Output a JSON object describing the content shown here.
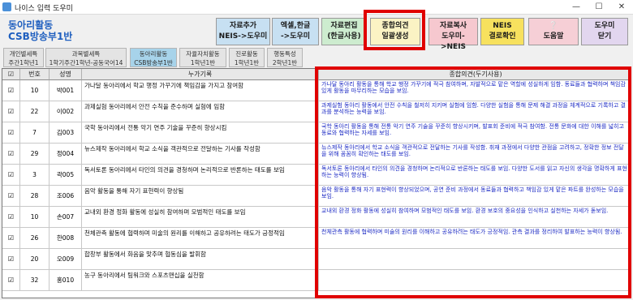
{
  "window": {
    "title": "나이스 입력 도우미",
    "min": "—",
    "max": "☐",
    "close": "✕"
  },
  "dept": {
    "line1": "동아리활동",
    "line2": "CSB방송부1반"
  },
  "toolbar": [
    {
      "id": "add",
      "l1": "자료추가",
      "l2": "NEIS->도우미",
      "bg": "#c7e0f2"
    },
    {
      "id": "excel",
      "l1": "엑셀,한글",
      "l2": "->도우미",
      "bg": "#c7e0f2"
    },
    {
      "id": "edit",
      "l1": "자료편집",
      "l2": "(한글사용)",
      "bg": "#cdeccf"
    },
    {
      "id": "bulk",
      "l1": "종합의견",
      "l2": "일괄생성",
      "bg": "#fbf3c4"
    },
    {
      "id": "copy",
      "l1": "자료복사",
      "l2": "도우미->NEIS",
      "bg": "#f6c8cf"
    },
    {
      "id": "check",
      "l1": "NEIS",
      "l2": "결로확인",
      "bg": "#f7e15e"
    },
    {
      "id": "help",
      "l1": "❔",
      "l2": "도움말",
      "bg": "#f6cfd6"
    },
    {
      "id": "close",
      "l1": "도우미",
      "l2": "닫기",
      "bg": "#e2d6ef"
    }
  ],
  "tabs": [
    {
      "l1": "개인별세특",
      "l2": "주간1학년1",
      "active": false
    },
    {
      "l1": "과목별세특",
      "l2": "1학기주간1학년-공동국어14",
      "active": false
    },
    {
      "l1": "동아리활동",
      "l2": "CSB방송부1반",
      "active": true
    },
    {
      "l1": "자율자치활동",
      "l2": "1학년1반",
      "active": false
    },
    {
      "l1": "진로활동",
      "l2": "1학년1반",
      "active": false
    },
    {
      "l1": "행동특성",
      "l2": "2학년1반",
      "active": false
    }
  ],
  "grid": {
    "headers": {
      "check": "☑",
      "number": "번호",
      "name": "성명",
      "record": "누가기록",
      "opinion": "종합의견(두기사용)"
    },
    "rows": [
      {
        "checked": "☑",
        "number": "10",
        "name": "박001",
        "record": "가나달 동아리에서 학교 행정 가꾸기에 책임감을 가지고 참여함",
        "opinion": "가나달 동아리 활동을 통해 학교 행정 가꾸기에 적극 참여하며, 자발적으로 맡은 역할에 성실하게 임함. 동료들과 협력하며 책임감 있게 활동을 마무리하는 모습을 보임."
      },
      {
        "checked": "☑",
        "number": "22",
        "name": "이002",
        "record": "과제실험 동아리에서 안전 수칙을 준수하며 실험에 임함",
        "opinion": "과제실험 동아리 활동에서 안전 수칙을 철저히 지키며 실험에 임함. 다양한 실험을 통해 문제 해결 과정을 체계적으로 기록하고 결과를 분석하는 능력을 보임."
      },
      {
        "checked": "☑",
        "number": "7",
        "name": "김003",
        "record": "국학 동아리에서 전통 악기 연주 기술을 꾸준히 향상시킴",
        "opinion": "국학 동아리 활동을 통해 전통 악기 연주 기술을 꾸준히 향상시키며, 발표회 준비에 적극 참여함. 전통 문화에 대한 이해를 넓히고 동료와 협력하는 자세를 보임."
      },
      {
        "checked": "☑",
        "number": "29",
        "name": "정004",
        "record": "뉴스제작 동아리에서 학교 소식을 객관적으로 전달하는 기사를 작성함",
        "opinion": "뉴스제작 동아리에서 학교 소식을 객관적으로 전달하는 기사를 작성함. 취재 과정에서 다양한 관점을 고려하고, 정확한 정보 전달을 위해 꼼꼼히 확인하는 태도를 보임."
      },
      {
        "checked": "☑",
        "number": "3",
        "name": "곽005",
        "record": "독서토론 동아리에서 타인의 의견을 경청하며 논리적으로 반론하는 태도를 보임",
        "opinion": "독서토론 동아리에서 타인의 의견을 경청하며 논리적으로 반론하는 태도를 보임. 다양한 도서를 읽고 자신의 생각을 명확하게 표현하는 능력이 향상됨."
      },
      {
        "checked": "☑",
        "number": "28",
        "name": "조006",
        "record": "음악 활동을 통해 자기 표현력이 향상됨",
        "opinion": "음악 활동을 통해 자기 표현력이 향상되었으며, 공연 준비 과정에서 동료들과 협력하고 책임감 있게 맡은 파트를 완성하는 모습을 보임."
      },
      {
        "checked": "☑",
        "number": "10",
        "name": "손007",
        "record": "교내외 환경 정화 활동에 성실히 참여하며 모범적인 태도를 보임",
        "opinion": "교내외 환경 정화 활동에 성실히 참여하며 모범적인 태도를 보임. 환경 보호의 중요성을 인식하고 실천하는 자세가 돋보임."
      },
      {
        "checked": "☑",
        "number": "26",
        "name": "한008",
        "record": "천체관측 활동에 협력하며 미술의 원리를 이해하고 공유하려는 태도가 긍정적임",
        "opinion": "천체관측 활동에 협력하며 미술의 원리를 이해하고 공유하려는 태도가 긍정적임. 관측 결과를 정리하여 발표하는 능력이 향상됨."
      },
      {
        "checked": "☑",
        "number": "20",
        "name": "오009",
        "record": "합창부 활동에서 화음을 맞추며 협동심을 발휘함",
        "opinion": ""
      },
      {
        "checked": "☑",
        "number": "32",
        "name": "홍010",
        "record": "농구 동아리에서 팀워크와 스포츠맨십을 실천함",
        "opinion": ""
      }
    ]
  }
}
